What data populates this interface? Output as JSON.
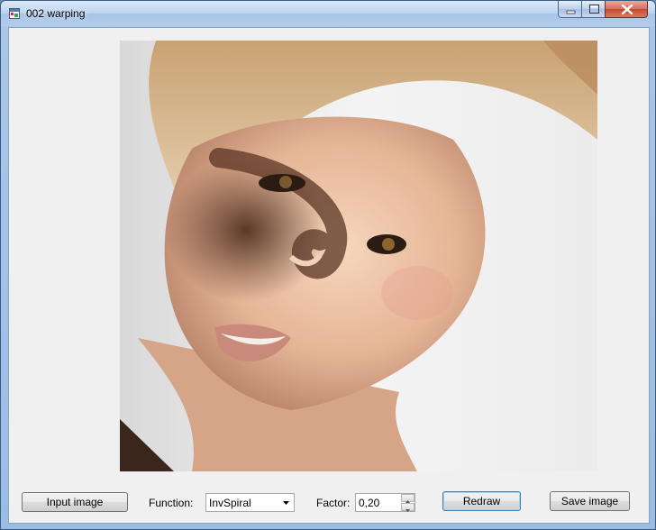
{
  "window": {
    "title": "002 warping"
  },
  "buttons": {
    "input_image": "Input image",
    "redraw": "Redraw",
    "save_image": "Save image"
  },
  "function": {
    "label": "Function:",
    "selected": "InvSpiral"
  },
  "factor": {
    "label": "Factor:",
    "value": "0,20"
  },
  "colors": {
    "titlebar": "#bcd3ee",
    "client": "#f0f0f0",
    "close": "#c44a33"
  }
}
